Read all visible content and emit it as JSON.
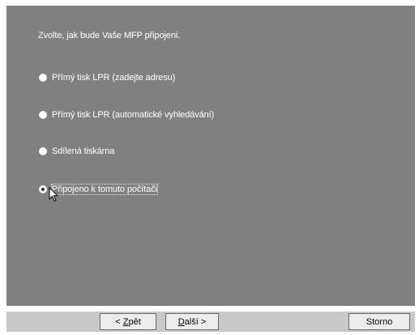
{
  "dialog": {
    "prompt": "Zvolte, jak bude Vaše MFP připojeni.",
    "options": [
      {
        "label": "Přímý tisk LPR (zadejte adresu)",
        "selected": false
      },
      {
        "label": "Přímý tisk LPR (automatické vyhledávání)",
        "selected": false
      },
      {
        "label": "Sdílená tiskárna",
        "selected": false
      },
      {
        "label": "Připojeno k tomuto počítači",
        "selected": true
      }
    ]
  },
  "buttons": {
    "back": {
      "prefix": "< ",
      "accel": "Z",
      "rest": "pět"
    },
    "next": {
      "accel": "D",
      "rest": "alší >"
    },
    "cancel": "Storno"
  },
  "colors": {
    "panel": "#808080",
    "button_bar": "#c8c8c8",
    "text": "#ffffff"
  },
  "cursor": "arrow-pointer-icon"
}
